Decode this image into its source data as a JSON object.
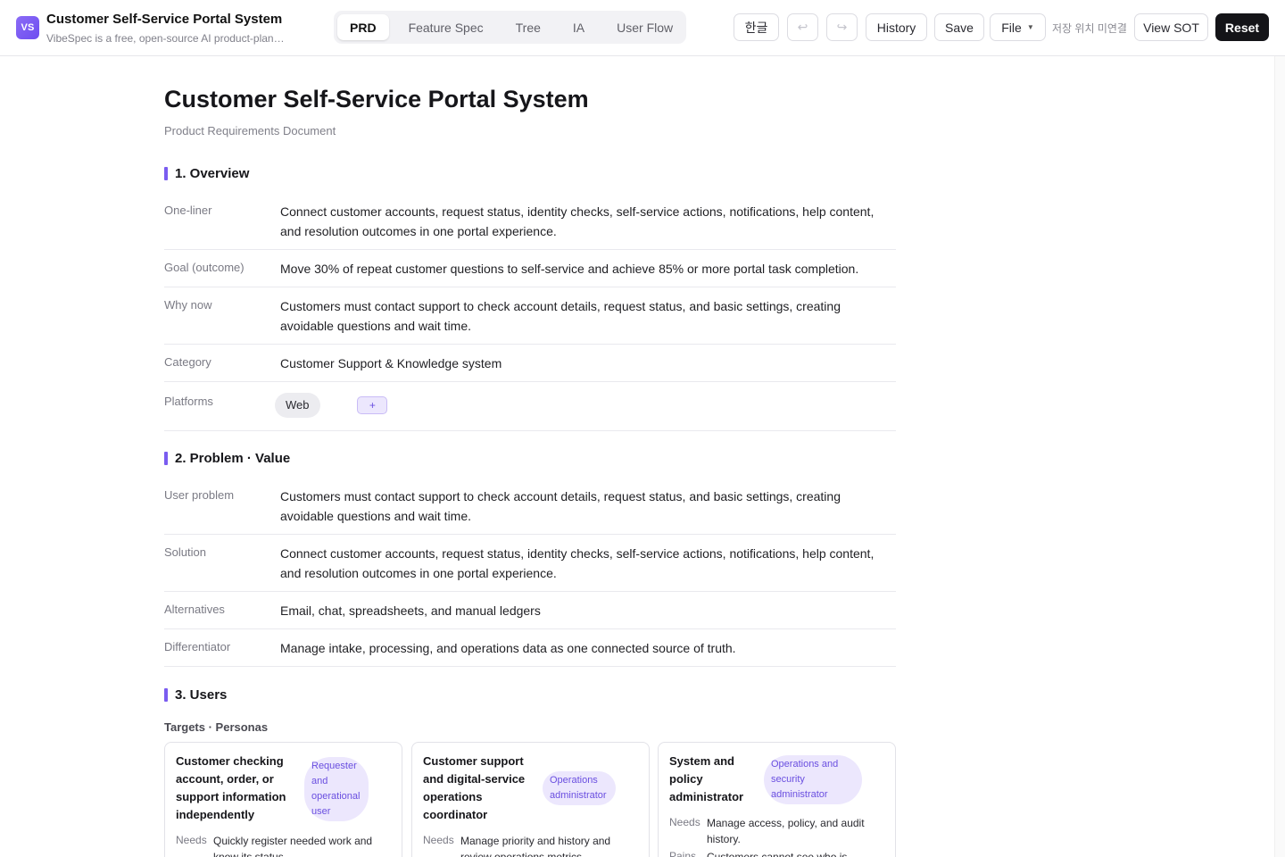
{
  "header": {
    "logo_text": "VS",
    "app_title": "Customer Self-Service Portal System",
    "app_subtitle": "VibeSpec is a free, open-source AI product-planning tool",
    "tabs": [
      {
        "label": "PRD",
        "active": true
      },
      {
        "label": "Feature Spec",
        "active": false
      },
      {
        "label": "Tree",
        "active": false
      },
      {
        "label": "IA",
        "active": false
      },
      {
        "label": "User Flow",
        "active": false
      }
    ],
    "lang_label": "한글",
    "undo_icon": "↩",
    "redo_icon": "↪",
    "history_label": "History",
    "save_label": "Save",
    "file_label": "File",
    "save_location": "저장 위치 미연결",
    "view_sot_label": "View SOT",
    "reset_label": "Reset"
  },
  "doc": {
    "title": "Customer Self-Service Portal System",
    "subtitle": "Product Requirements Document"
  },
  "overview": {
    "heading": "1. Overview",
    "rows": [
      {
        "k": "One-liner",
        "v": "Connect customer accounts, request status, identity checks, self-service actions, notifications, help content, and resolution outcomes in one portal experience."
      },
      {
        "k": "Goal (outcome)",
        "v": "Move 30% of repeat customer questions to self-service and achieve 85% or more portal task completion."
      },
      {
        "k": "Why now",
        "v": "Customers must contact support to check account details, request status, and basic settings, creating avoidable questions and wait time."
      },
      {
        "k": "Category",
        "v": "Customer Support & Knowledge system"
      }
    ],
    "platforms_label": "Platforms",
    "platforms": [
      "Web"
    ],
    "add_platform": "+"
  },
  "problem": {
    "heading": "2. Problem · Value",
    "rows": [
      {
        "k": "User problem",
        "v": "Customers must contact support to check account details, request status, and basic settings, creating avoidable questions and wait time."
      },
      {
        "k": "Solution",
        "v": "Connect customer accounts, request status, identity checks, self-service actions, notifications, help content, and resolution outcomes in one portal experience."
      },
      {
        "k": "Alternatives",
        "v": "Email, chat, spreadsheets, and manual ledgers"
      },
      {
        "k": "Differentiator",
        "v": "Manage intake, processing, and operations data as one connected source of truth."
      }
    ]
  },
  "users": {
    "heading": "3. Users",
    "targets_heading": "Targets · Personas",
    "personas": [
      {
        "name": "Customer checking account, order, or support information independently",
        "tag": "Requester and operational user",
        "needs_label": "Needs",
        "needs": "Quickly register needed work and know its status."
      },
      {
        "name": "Customer support and digital-service operations coordinator",
        "tag": "Operations administrator",
        "needs_label": "Needs",
        "needs": "Manage priority and history and review operations metrics."
      },
      {
        "name": "System and policy administrator",
        "tag": "Operations and security administrator",
        "needs_label": "Needs",
        "needs": "Manage access, policy, and audit history.",
        "pains_label": "Pains",
        "pains": "Customers cannot see who is responsible."
      }
    ]
  }
}
